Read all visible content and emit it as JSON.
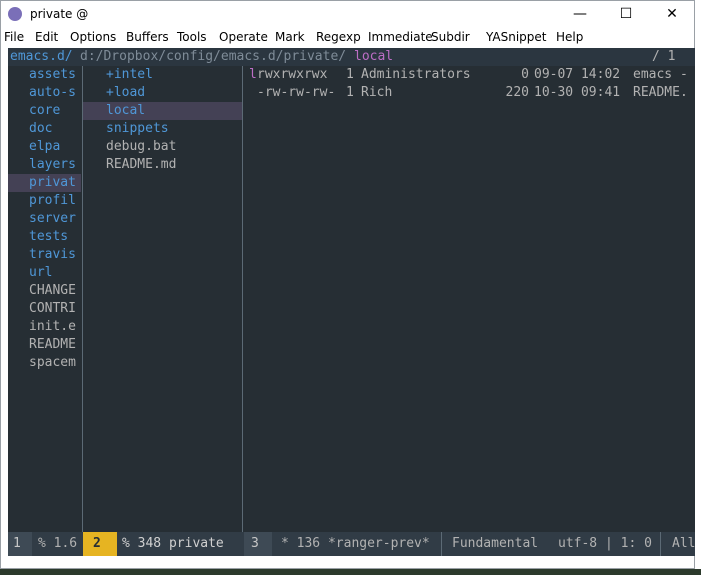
{
  "window": {
    "title": "private @"
  },
  "menu": [
    "File",
    "Edit",
    "Options",
    "Buffers",
    "Tools",
    "Operate",
    "Mark",
    "Regexp",
    "Immediate",
    "Subdir",
    "YASnippet",
    "Help"
  ],
  "header": {
    "root": "emacs.d/",
    "path_prefix": "d:/Dropbox/config/emacs.d/private/",
    "path_current": "local",
    "position": "/ 1"
  },
  "left_column": [
    "assets",
    "auto-s",
    "core",
    "doc",
    "elpa",
    "layers",
    "privat",
    "profil",
    "server",
    "tests",
    "travis",
    "url",
    "CHANGE",
    "CONTRI",
    "init.e",
    "README",
    "spacem"
  ],
  "left_selected_index": 6,
  "left_dir_count": 12,
  "middle_column": [
    "+intel",
    "+load",
    "local",
    "snippets",
    "debug.bat",
    "README.md"
  ],
  "middle_selected_index": 2,
  "middle_dir_count": 4,
  "preview_rows": [
    {
      "perm_first": "l",
      "perm_rest": "rwxrwxrwx",
      "links": "1",
      "owner": "Administrators",
      "size": "0",
      "date": "09-07 14:02",
      "name": "emacs -"
    },
    {
      "perm_first": "",
      "perm_rest": "-rw-rw-rw-",
      "links": "1",
      "owner": "Rich",
      "size": "220",
      "date": "10-30 09:41",
      "name": "README."
    }
  ],
  "modeline": {
    "win1": "1",
    "win1_text": "% 1.6",
    "win2": "2",
    "win2_text": "% 348 private",
    "win3": "3",
    "win3_text": "* 136 *ranger-prev*",
    "major_mode": "Fundamental",
    "encoding": "utf-8 | 1: 0",
    "all": "All"
  },
  "colors": {
    "frame_bg": "#262e34",
    "dir": "#4f97d7",
    "file": "#b2b2b2",
    "selection": "#444155",
    "root": "#4f97d7",
    "current": "#bc6ec5"
  }
}
